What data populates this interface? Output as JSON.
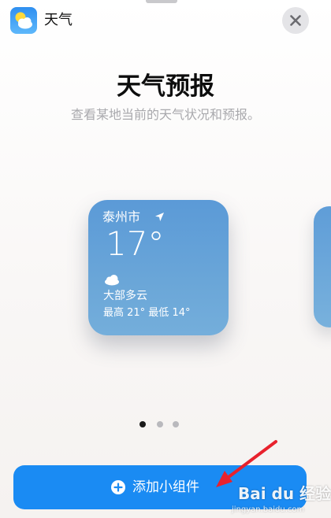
{
  "header": {
    "app_name": "天气",
    "app_icon": "weather-app-icon",
    "close_icon": "close-icon"
  },
  "intro": {
    "title": "天气预报",
    "subtitle": "查看某地当前的天气状况和预报。"
  },
  "widget": {
    "city": "泰州市",
    "location_icon": "location-arrow-icon",
    "temperature": "17°",
    "condition_icon": "cloud-icon",
    "condition": "大部多云",
    "high_low": "最高 21° 最低 14°",
    "color": "#6aa6d8"
  },
  "pager": {
    "count": 3,
    "active": 0
  },
  "add_button": {
    "icon": "plus-circle-icon",
    "label": "添加小组件",
    "color": "#1a8bf3"
  },
  "annotation": {
    "arrow_color": "#e8222d"
  },
  "watermark": {
    "logo": "Bai du 经验",
    "url": "jingyan.baidu.com"
  }
}
